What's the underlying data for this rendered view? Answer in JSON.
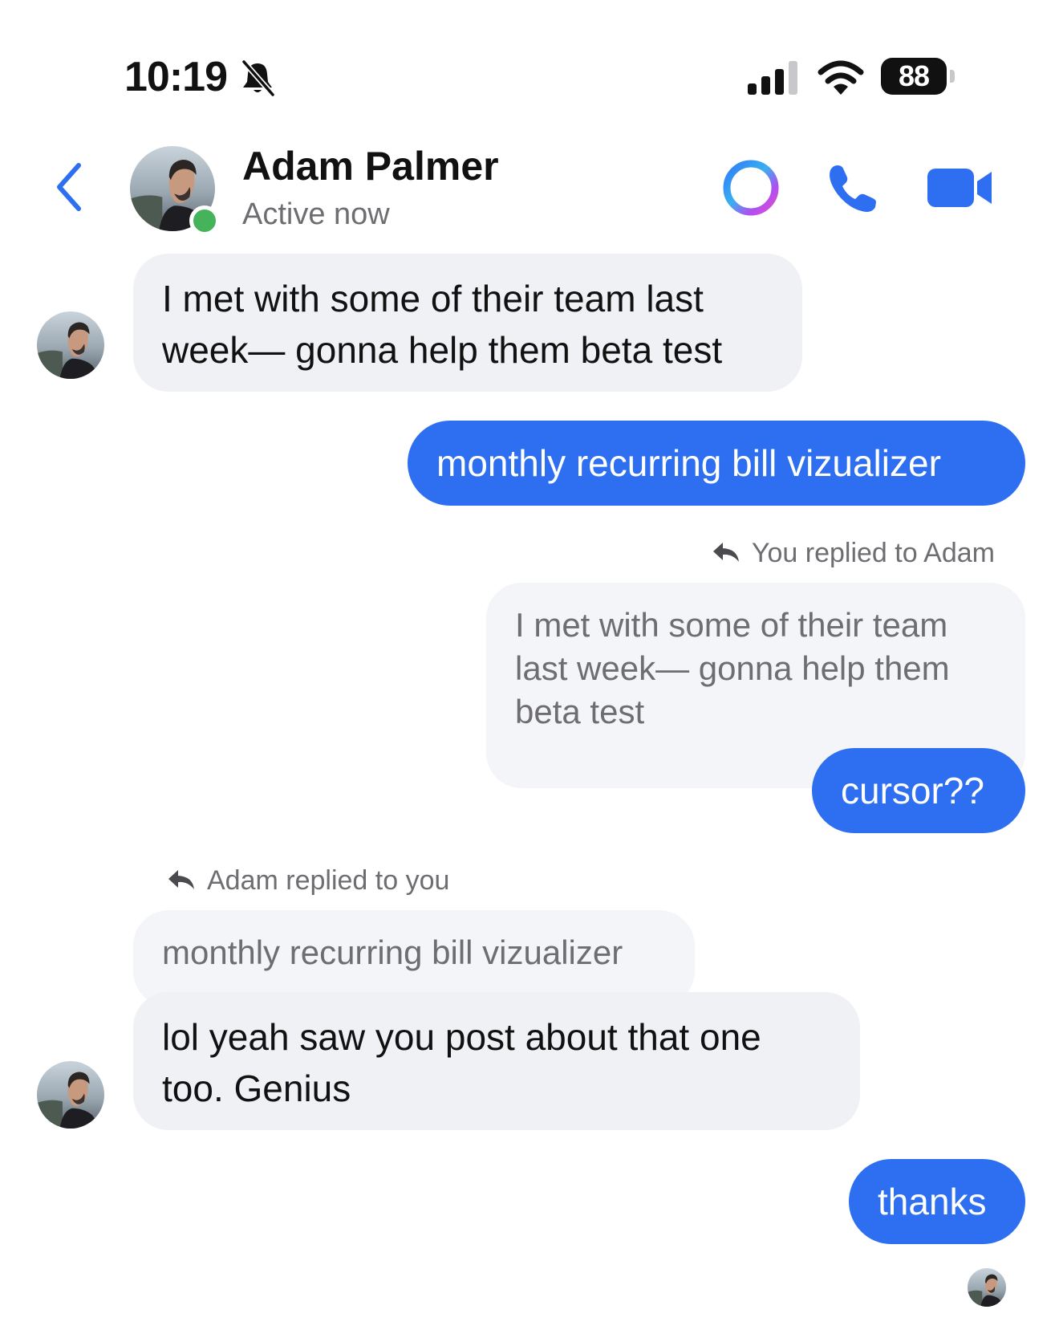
{
  "status_bar": {
    "time": "10:19",
    "battery": "88",
    "icons": [
      "bell-slash-icon",
      "cellular-signal-icon",
      "wifi-icon",
      "battery-icon"
    ]
  },
  "header": {
    "contact_name": "Adam Palmer",
    "status": "Active now",
    "icons": [
      "back-chevron-icon",
      "meta-ai-ring-icon",
      "phone-icon",
      "video-camera-icon"
    ]
  },
  "colors": {
    "accent": "#2d6ff0",
    "incoming_bubble": "#f0f1f5",
    "online": "#44b35a",
    "secondary_text": "#6d6d72"
  },
  "messages": [
    {
      "direction": "incoming",
      "lines": [
        "I met with some of their team last",
        "week— gonna help them beta test"
      ]
    },
    {
      "direction": "outgoing",
      "text": "monthly recurring bill vizualizer"
    },
    {
      "direction": "outgoing",
      "reply_label": "You replied to Adam",
      "quoted_lines": [
        "I met with some of their team",
        "last week— gonna help them",
        "beta test"
      ],
      "text": "cursor??"
    },
    {
      "direction": "incoming",
      "reply_label": "Adam replied to you",
      "quoted_lines": [
        "monthly recurring bill vizualizer"
      ],
      "lines": [
        "lol yeah saw you post about that one",
        "too. Genius"
      ]
    },
    {
      "direction": "outgoing",
      "text": "thanks"
    }
  ]
}
